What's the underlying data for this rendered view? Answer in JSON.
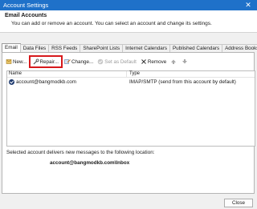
{
  "window": {
    "title": "Account Settings",
    "close_glyph": "✕"
  },
  "header": {
    "title": "Email Accounts",
    "subtitle": "You can add or remove an account. You can select an account and change its settings."
  },
  "tabs": [
    {
      "label": "Email",
      "active": true
    },
    {
      "label": "Data Files",
      "active": false
    },
    {
      "label": "RSS Feeds",
      "active": false
    },
    {
      "label": "SharePoint Lists",
      "active": false
    },
    {
      "label": "Internet Calendars",
      "active": false
    },
    {
      "label": "Published Calendars",
      "active": false
    },
    {
      "label": "Address Books",
      "active": false
    }
  ],
  "toolbar": {
    "new_label": "New...",
    "repair_label": "Repair...",
    "change_label": "Change...",
    "set_default_label": "Set as Default",
    "remove_label": "Remove",
    "highlight_color": "#d7191c"
  },
  "list": {
    "columns": [
      "Name",
      "Type"
    ],
    "rows": [
      {
        "name": "account@bangmodkb.com",
        "type": "IMAP/SMTP (send from this account by default)"
      }
    ]
  },
  "delivery": {
    "text": "Selected account delivers new messages to the following location:",
    "location": "account@bangmodkb.com\\Inbox"
  },
  "footer": {
    "close_label": "Close"
  },
  "colors": {
    "titlebar": "#1f71c9",
    "dialog_bg": "#f0f0f0"
  }
}
